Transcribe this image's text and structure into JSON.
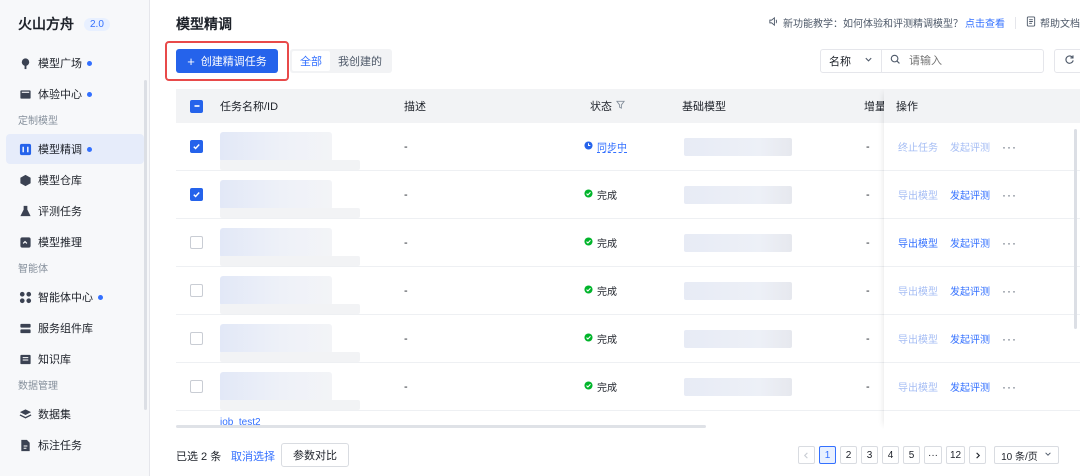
{
  "sidebar": {
    "brand": "火山方舟",
    "version": "2.0",
    "items": [
      {
        "type": "item",
        "label": "模型广场",
        "icon": "model-plaza-icon",
        "dot": true
      },
      {
        "type": "item",
        "label": "体验中心",
        "icon": "experience-icon",
        "dot": true
      },
      {
        "type": "group",
        "label": "定制模型"
      },
      {
        "type": "item",
        "label": "模型精调",
        "icon": "finetune-icon",
        "dot": true,
        "active": true
      },
      {
        "type": "item",
        "label": "模型仓库",
        "icon": "cube-icon",
        "dot": false
      },
      {
        "type": "item",
        "label": "评测任务",
        "icon": "flask-icon",
        "dot": false
      },
      {
        "type": "item",
        "label": "模型推理",
        "icon": "inference-icon",
        "dot": false
      },
      {
        "type": "group",
        "label": "智能体"
      },
      {
        "type": "item",
        "label": "智能体中心",
        "icon": "agent-grid-icon",
        "dot": true
      },
      {
        "type": "item",
        "label": "服务组件库",
        "icon": "component-icon",
        "dot": false
      },
      {
        "type": "item",
        "label": "知识库",
        "icon": "knowledge-icon",
        "dot": false
      },
      {
        "type": "group",
        "label": "数据管理"
      },
      {
        "type": "item",
        "label": "数据集",
        "icon": "layers-icon",
        "dot": false
      },
      {
        "type": "item",
        "label": "标注任务",
        "icon": "annotate-icon",
        "dot": false
      }
    ]
  },
  "header": {
    "title": "模型精调",
    "tutorial_prefix": "新功能教学：如何体验和评测精调模型？",
    "tutorial_link": "点击查看",
    "help_label": "帮助文档"
  },
  "toolbar": {
    "create_label": "创建精调任务",
    "tabs": [
      {
        "label": "全部",
        "active": true
      },
      {
        "label": "我创建的",
        "active": false
      }
    ],
    "filter_field": "名称",
    "search_placeholder": "请输入"
  },
  "table": {
    "columns": {
      "name": "任务名称/ID",
      "desc": "描述",
      "status": "状态",
      "base_model": "基础模型",
      "incremental": "增量",
      "actions": "操作"
    },
    "rows": [
      {
        "checked": true,
        "desc": "-",
        "status": "同步中",
        "status_kind": "sync",
        "incremental": "-",
        "action1": "终止任务",
        "action1_style": "muted",
        "action2": "发起评测",
        "action2_style": "muted"
      },
      {
        "checked": true,
        "desc": "-",
        "status": "完成",
        "status_kind": "done",
        "incremental": "-",
        "action1": "导出模型",
        "action1_style": "muted",
        "action2": "发起评测",
        "action2_style": "strong"
      },
      {
        "checked": false,
        "desc": "-",
        "status": "完成",
        "status_kind": "done",
        "incremental": "-",
        "action1": "导出模型",
        "action1_style": "strong",
        "action2": "发起评测",
        "action2_style": "strong"
      },
      {
        "checked": false,
        "desc": "-",
        "status": "完成",
        "status_kind": "done",
        "incremental": "-",
        "action1": "导出模型",
        "action1_style": "muted",
        "action2": "发起评测",
        "action2_style": "strong"
      },
      {
        "checked": false,
        "desc": "-",
        "status": "完成",
        "status_kind": "done",
        "incremental": "-",
        "action1": "导出模型",
        "action1_style": "muted",
        "action2": "发起评测",
        "action2_style": "strong"
      },
      {
        "checked": false,
        "desc": "-",
        "status": "完成",
        "status_kind": "done",
        "incremental": "-",
        "action1": "导出模型",
        "action1_style": "muted",
        "action2": "发起评测",
        "action2_style": "strong"
      }
    ],
    "partial_row_name": "job_test2"
  },
  "footer": {
    "selected_text": "已选 2 条",
    "cancel_label": "取消选择",
    "compare_label": "参数对比",
    "pages": [
      "1",
      "2",
      "3",
      "4",
      "5",
      "···",
      "12"
    ],
    "current_page": "1",
    "page_size": "10 条/页"
  },
  "colors": {
    "primary": "#2563eb",
    "highlight_border": "#e84a4a",
    "success": "#00b42a",
    "link": "#3370ff"
  }
}
